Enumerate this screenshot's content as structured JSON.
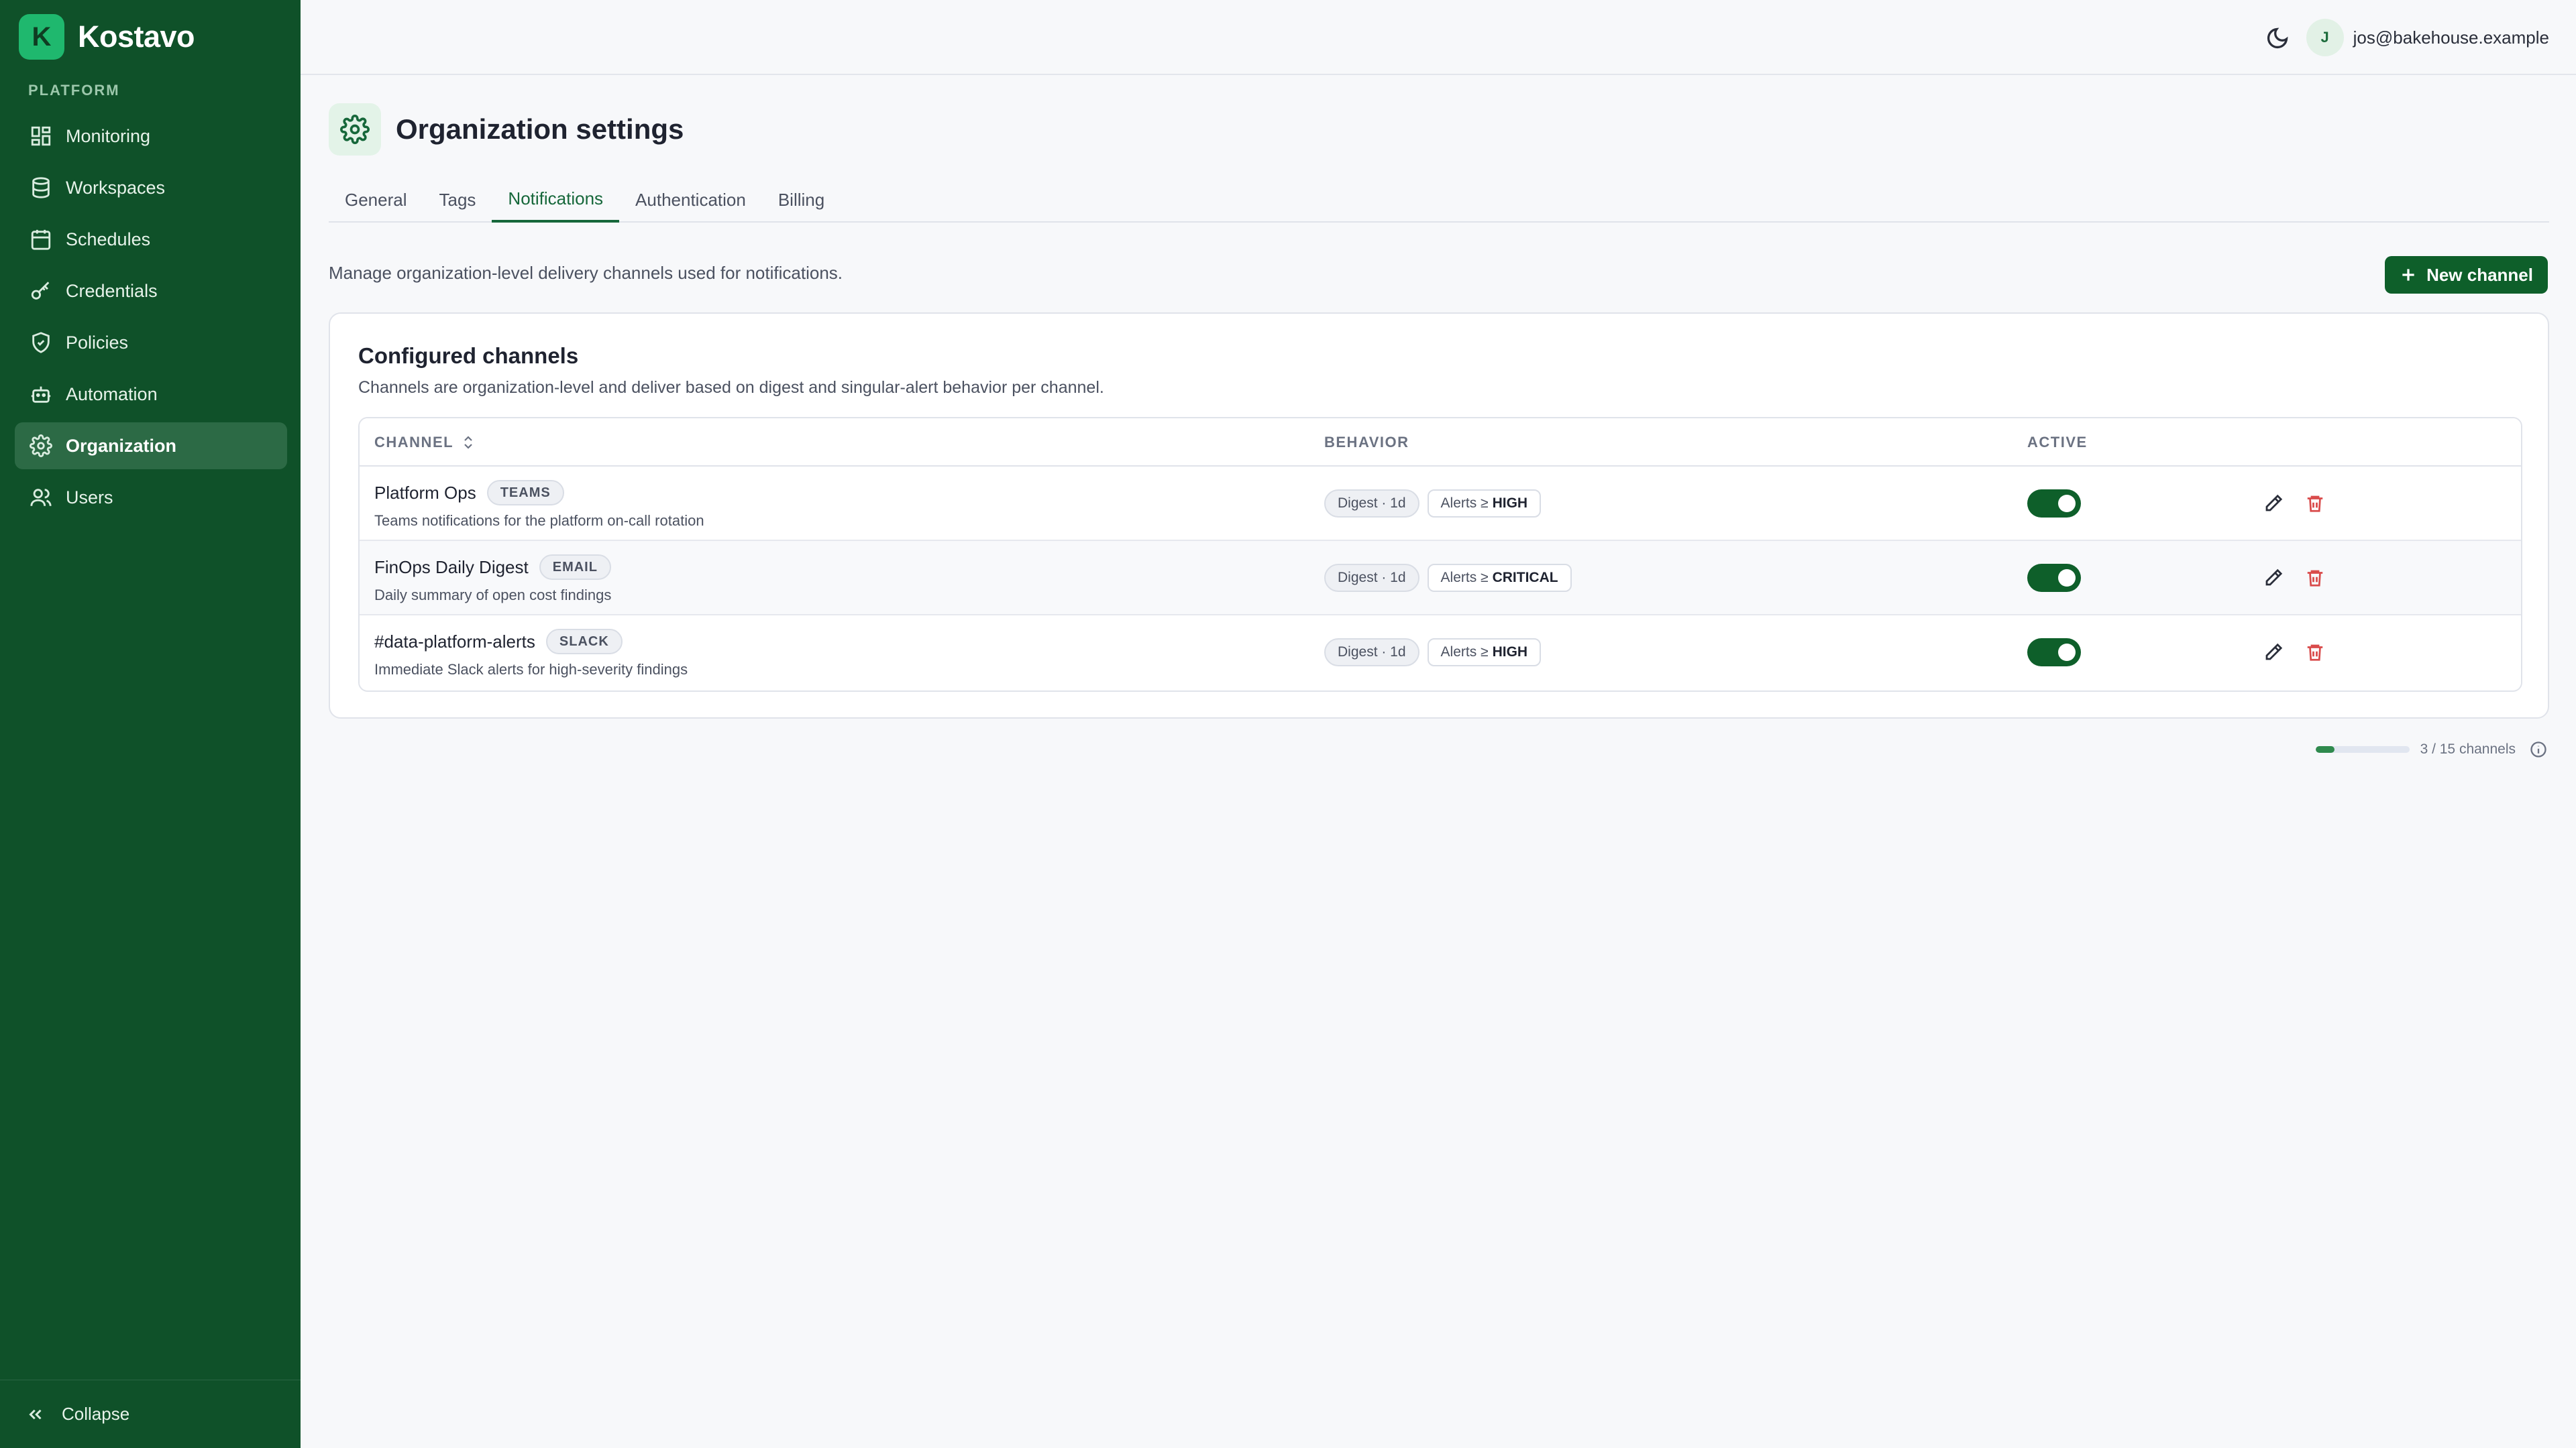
{
  "app": {
    "name": "Kostavo",
    "logo_letter": "K"
  },
  "sidebar": {
    "section_label": "PLATFORM",
    "items": [
      {
        "label": "Monitoring",
        "icon": "grid-icon"
      },
      {
        "label": "Workspaces",
        "icon": "database-icon"
      },
      {
        "label": "Schedules",
        "icon": "calendar-icon"
      },
      {
        "label": "Credentials",
        "icon": "key-icon"
      },
      {
        "label": "Policies",
        "icon": "shield-icon"
      },
      {
        "label": "Automation",
        "icon": "robot-icon"
      },
      {
        "label": "Organization",
        "icon": "gear-icon",
        "active": true
      },
      {
        "label": "Users",
        "icon": "users-icon"
      }
    ],
    "collapse_label": "Collapse"
  },
  "topbar": {
    "user_initial": "J",
    "user_email": "jos@bakehouse.example"
  },
  "page": {
    "title": "Organization settings",
    "tabs": [
      "General",
      "Tags",
      "Notifications",
      "Authentication",
      "Billing"
    ],
    "active_tab": "Notifications",
    "description": "Manage organization-level delivery channels used for notifications.",
    "new_button": "New channel"
  },
  "card": {
    "title": "Configured channels",
    "subtitle": "Channels are organization-level and deliver based on digest and singular-alert behavior per channel.",
    "columns": {
      "channel": "CHANNEL",
      "behavior": "BEHAVIOR",
      "active": "ACTIVE"
    },
    "rows": [
      {
        "name": "Platform Ops",
        "type": "TEAMS",
        "description": "Teams notifications for the platform on-call rotation",
        "digest": "Digest · 1d",
        "alerts_prefix": "Alerts ≥",
        "alerts_level": "HIGH",
        "active": true
      },
      {
        "name": "FinOps Daily Digest",
        "type": "EMAIL",
        "description": "Daily summary of open cost findings",
        "digest": "Digest · 1d",
        "alerts_prefix": "Alerts ≥",
        "alerts_level": "CRITICAL",
        "active": true
      },
      {
        "name": "#data-platform-alerts",
        "type": "SLACK",
        "description": "Immediate Slack alerts for high-severity findings",
        "digest": "Digest · 1d",
        "alerts_prefix": "Alerts ≥",
        "alerts_level": "HIGH",
        "active": true
      }
    ]
  },
  "usage": {
    "text": "3 / 15 channels",
    "used": 3,
    "limit": 15
  },
  "colors": {
    "sidebar": "#0f5129",
    "accent": "#0e5f2a",
    "danger": "#d94b4b"
  }
}
